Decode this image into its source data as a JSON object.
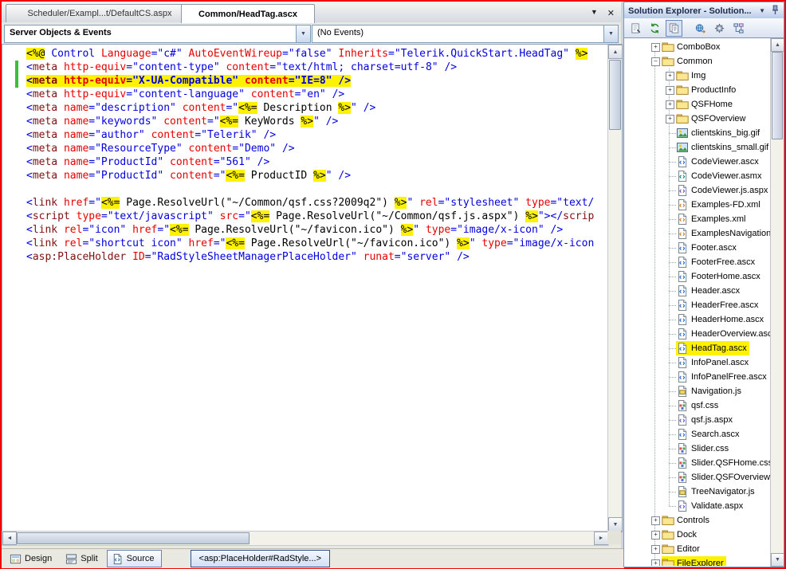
{
  "icons": {
    "tab_menu": "▼",
    "tab_close": "✕",
    "combo_arrow": "▼",
    "title_menu": "▼",
    "scroll_up": "▲",
    "scroll_down": "▼",
    "scroll_left": "◄",
    "scroll_right": "►"
  },
  "editor": {
    "tabs": [
      {
        "label": "Scheduler/Exampl...t/DefaultCS.aspx"
      },
      {
        "label": "Common/HeadTag.ascx"
      }
    ],
    "object_dropdown": "Server Objects & Events",
    "events_dropdown": "(No Events)",
    "view_buttons": [
      {
        "label": "Design"
      },
      {
        "label": "Split"
      },
      {
        "label": "Source"
      }
    ],
    "breadcrumb_tab": "<asp:PlaceHolder#RadStyle...>"
  },
  "code": {
    "lines": [
      {
        "segs": [
          [
            "s",
            "<%@"
          ],
          [
            "x",
            " "
          ],
          [
            "k",
            "Control"
          ],
          [
            "x",
            " "
          ],
          [
            "a",
            "Language"
          ],
          [
            "v",
            "=\"c#\""
          ],
          [
            "x",
            " "
          ],
          [
            "a",
            "AutoEventWireup"
          ],
          [
            "v",
            "=\"false\""
          ],
          [
            "x",
            " "
          ],
          [
            "a",
            "Inherits"
          ],
          [
            "v",
            "=\"Telerik.QuickStart.HeadTag\""
          ],
          [
            "x",
            " "
          ],
          [
            "s",
            "%>"
          ]
        ]
      },
      {
        "bar": true,
        "segs": [
          [
            "d",
            "<"
          ],
          [
            "t",
            "meta"
          ],
          [
            "x",
            " "
          ],
          [
            "a",
            "http-equiv"
          ],
          [
            "v",
            "=\"content-type\""
          ],
          [
            "x",
            " "
          ],
          [
            "a",
            "content"
          ],
          [
            "v",
            "=\"text/html; charset=utf-8\""
          ],
          [
            "x",
            " "
          ],
          [
            "d",
            "/>"
          ]
        ]
      },
      {
        "bar": true,
        "hl": true,
        "segs": [
          [
            "d",
            "<"
          ],
          [
            "t",
            "meta"
          ],
          [
            "x",
            " "
          ],
          [
            "a",
            "http-equiv"
          ],
          [
            "v",
            "=\"X-UA-Compatible\""
          ],
          [
            "x",
            " "
          ],
          [
            "a",
            "content"
          ],
          [
            "v",
            "=\"IE=8\""
          ],
          [
            "x",
            " "
          ],
          [
            "d",
            "/>"
          ]
        ]
      },
      {
        "segs": [
          [
            "d",
            "<"
          ],
          [
            "t",
            "meta"
          ],
          [
            "x",
            " "
          ],
          [
            "a",
            "http-equiv"
          ],
          [
            "v",
            "=\"content-language\""
          ],
          [
            "x",
            " "
          ],
          [
            "a",
            "content"
          ],
          [
            "v",
            "=\"en\""
          ],
          [
            "x",
            " "
          ],
          [
            "d",
            "/>"
          ]
        ]
      },
      {
        "segs": [
          [
            "d",
            "<"
          ],
          [
            "t",
            "meta"
          ],
          [
            "x",
            " "
          ],
          [
            "a",
            "name"
          ],
          [
            "v",
            "=\"description\""
          ],
          [
            "x",
            " "
          ],
          [
            "a",
            "content"
          ],
          [
            "v",
            "=\""
          ],
          [
            "s",
            "<%="
          ],
          [
            "x",
            " Description "
          ],
          [
            "s",
            "%>"
          ],
          [
            "v",
            "\""
          ],
          [
            "x",
            " "
          ],
          [
            "d",
            "/>"
          ]
        ]
      },
      {
        "segs": [
          [
            "d",
            "<"
          ],
          [
            "t",
            "meta"
          ],
          [
            "x",
            " "
          ],
          [
            "a",
            "name"
          ],
          [
            "v",
            "=\"keywords\""
          ],
          [
            "x",
            " "
          ],
          [
            "a",
            "content"
          ],
          [
            "v",
            "=\""
          ],
          [
            "s",
            "<%="
          ],
          [
            "x",
            " KeyWords "
          ],
          [
            "s",
            "%>"
          ],
          [
            "v",
            "\""
          ],
          [
            "x",
            " "
          ],
          [
            "d",
            "/>"
          ]
        ]
      },
      {
        "segs": [
          [
            "d",
            "<"
          ],
          [
            "t",
            "meta"
          ],
          [
            "x",
            " "
          ],
          [
            "a",
            "name"
          ],
          [
            "v",
            "=\"author\""
          ],
          [
            "x",
            " "
          ],
          [
            "a",
            "content"
          ],
          [
            "v",
            "=\"Telerik\""
          ],
          [
            "x",
            " "
          ],
          [
            "d",
            "/>"
          ]
        ]
      },
      {
        "segs": [
          [
            "d",
            "<"
          ],
          [
            "t",
            "meta"
          ],
          [
            "x",
            " "
          ],
          [
            "a",
            "name"
          ],
          [
            "v",
            "=\"ResourceType\""
          ],
          [
            "x",
            " "
          ],
          [
            "a",
            "content"
          ],
          [
            "v",
            "=\"Demo\""
          ],
          [
            "x",
            " "
          ],
          [
            "d",
            "/>"
          ]
        ]
      },
      {
        "segs": [
          [
            "d",
            "<"
          ],
          [
            "t",
            "meta"
          ],
          [
            "x",
            " "
          ],
          [
            "a",
            "name"
          ],
          [
            "v",
            "=\"ProductId\""
          ],
          [
            "x",
            " "
          ],
          [
            "a",
            "content"
          ],
          [
            "v",
            "=\"561\""
          ],
          [
            "x",
            " "
          ],
          [
            "d",
            "/>"
          ]
        ]
      },
      {
        "segs": [
          [
            "d",
            "<"
          ],
          [
            "t",
            "meta"
          ],
          [
            "x",
            " "
          ],
          [
            "a",
            "name"
          ],
          [
            "v",
            "=\"ProductId\""
          ],
          [
            "x",
            " "
          ],
          [
            "a",
            "content"
          ],
          [
            "v",
            "=\""
          ],
          [
            "s",
            "<%="
          ],
          [
            "x",
            " ProductID "
          ],
          [
            "s",
            "%>"
          ],
          [
            "v",
            "\""
          ],
          [
            "x",
            " "
          ],
          [
            "d",
            "/>"
          ]
        ]
      },
      {
        "segs": []
      },
      {
        "segs": [
          [
            "d",
            "<"
          ],
          [
            "t",
            "link"
          ],
          [
            "x",
            " "
          ],
          [
            "a",
            "href"
          ],
          [
            "v",
            "=\""
          ],
          [
            "s",
            "<%="
          ],
          [
            "x",
            " Page.ResolveUrl(\"~/Common/qsf.css?2009q2\") "
          ],
          [
            "s",
            "%>"
          ],
          [
            "v",
            "\""
          ],
          [
            "x",
            " "
          ],
          [
            "a",
            "rel"
          ],
          [
            "v",
            "=\"stylesheet\""
          ],
          [
            "x",
            " "
          ],
          [
            "a",
            "type"
          ],
          [
            "v",
            "=\"text/"
          ]
        ]
      },
      {
        "segs": [
          [
            "d",
            "<"
          ],
          [
            "t",
            "script"
          ],
          [
            "x",
            " "
          ],
          [
            "a",
            "type"
          ],
          [
            "v",
            "=\"text/javascript\""
          ],
          [
            "x",
            " "
          ],
          [
            "a",
            "src"
          ],
          [
            "v",
            "=\""
          ],
          [
            "s",
            "<%="
          ],
          [
            "x",
            " Page.ResolveUrl(\"~/Common/qsf.js.aspx\") "
          ],
          [
            "s",
            "%>"
          ],
          [
            "v",
            "\""
          ],
          [
            "d",
            "></"
          ],
          [
            "t",
            "scrip"
          ]
        ]
      },
      {
        "segs": [
          [
            "d",
            "<"
          ],
          [
            "t",
            "link"
          ],
          [
            "x",
            " "
          ],
          [
            "a",
            "rel"
          ],
          [
            "v",
            "=\"icon\""
          ],
          [
            "x",
            " "
          ],
          [
            "a",
            "href"
          ],
          [
            "v",
            "=\""
          ],
          [
            "s",
            "<%="
          ],
          [
            "x",
            " Page.ResolveUrl(\"~/favicon.ico\") "
          ],
          [
            "s",
            "%>"
          ],
          [
            "v",
            "\""
          ],
          [
            "x",
            " "
          ],
          [
            "a",
            "type"
          ],
          [
            "v",
            "=\"image/x-icon\""
          ],
          [
            "x",
            " "
          ],
          [
            "d",
            "/>"
          ]
        ]
      },
      {
        "segs": [
          [
            "d",
            "<"
          ],
          [
            "t",
            "link"
          ],
          [
            "x",
            " "
          ],
          [
            "a",
            "rel"
          ],
          [
            "v",
            "=\"shortcut icon\""
          ],
          [
            "x",
            " "
          ],
          [
            "a",
            "href"
          ],
          [
            "v",
            "=\""
          ],
          [
            "s",
            "<%="
          ],
          [
            "x",
            " Page.ResolveUrl(\"~/favicon.ico\") "
          ],
          [
            "s",
            "%>"
          ],
          [
            "v",
            "\""
          ],
          [
            "x",
            " "
          ],
          [
            "a",
            "type"
          ],
          [
            "v",
            "=\"image/x-icon"
          ]
        ]
      },
      {
        "segs": [
          [
            "d",
            "<"
          ],
          [
            "t",
            "asp:PlaceHolder"
          ],
          [
            "x",
            " "
          ],
          [
            "a",
            "ID"
          ],
          [
            "v",
            "=\"RadStyleSheetManagerPlaceHolder\""
          ],
          [
            "x",
            " "
          ],
          [
            "a",
            "runat"
          ],
          [
            "v",
            "=\"server\""
          ],
          [
            "x",
            " "
          ],
          [
            "d",
            "/>"
          ]
        ]
      }
    ]
  },
  "solution_explorer": {
    "title": "Solution Explorer - Solution...",
    "tree": [
      {
        "label": "ComboBox",
        "icon": "folder",
        "level": 1,
        "exp": "+"
      },
      {
        "label": "Common",
        "icon": "folder",
        "level": 1,
        "exp": "-"
      },
      {
        "label": "Img",
        "icon": "folder",
        "level": 2,
        "exp": "+"
      },
      {
        "label": "ProductInfo",
        "icon": "folder",
        "level": 2,
        "exp": "+"
      },
      {
        "label": "QSFHome",
        "icon": "folder",
        "level": 2,
        "exp": "+"
      },
      {
        "label": "QSFOverview",
        "icon": "folder",
        "level": 2,
        "exp": "+"
      },
      {
        "label": "clientskins_big.gif",
        "icon": "image",
        "level": 2
      },
      {
        "label": "clientskins_small.gif",
        "icon": "image",
        "level": 2
      },
      {
        "label": "CodeViewer.ascx",
        "icon": "ascx",
        "level": 2
      },
      {
        "label": "CodeViewer.asmx",
        "icon": "asmx",
        "level": 2
      },
      {
        "label": "CodeViewer.js.aspx",
        "icon": "aspx",
        "level": 2
      },
      {
        "label": "Examples-FD.xml",
        "icon": "xml",
        "level": 2
      },
      {
        "label": "Examples.xml",
        "icon": "xml",
        "level": 2
      },
      {
        "label": "ExamplesNavigation",
        "icon": "xml",
        "level": 2
      },
      {
        "label": "Footer.ascx",
        "icon": "ascx",
        "level": 2
      },
      {
        "label": "FooterFree.ascx",
        "icon": "ascx",
        "level": 2
      },
      {
        "label": "FooterHome.ascx",
        "icon": "ascx",
        "level": 2
      },
      {
        "label": "Header.ascx",
        "icon": "ascx",
        "level": 2
      },
      {
        "label": "HeaderFree.ascx",
        "icon": "ascx",
        "level": 2
      },
      {
        "label": "HeaderHome.ascx",
        "icon": "ascx",
        "level": 2
      },
      {
        "label": "HeaderOverview.asc",
        "icon": "ascx",
        "level": 2
      },
      {
        "label": "HeadTag.ascx",
        "icon": "ascx",
        "level": 2,
        "highlight": true
      },
      {
        "label": "InfoPanel.ascx",
        "icon": "ascx",
        "level": 2
      },
      {
        "label": "InfoPanelFree.ascx",
        "icon": "ascx",
        "level": 2
      },
      {
        "label": "Navigation.js",
        "icon": "js",
        "level": 2
      },
      {
        "label": "qsf.css",
        "icon": "css",
        "level": 2
      },
      {
        "label": "qsf.js.aspx",
        "icon": "aspx",
        "level": 2
      },
      {
        "label": "Search.ascx",
        "icon": "ascx",
        "level": 2
      },
      {
        "label": "Slider.css",
        "icon": "css",
        "level": 2
      },
      {
        "label": "Slider.QSFHome.css",
        "icon": "css",
        "level": 2
      },
      {
        "label": "Slider.QSFOverview.",
        "icon": "css",
        "level": 2
      },
      {
        "label": "TreeNavigator.js",
        "icon": "js",
        "level": 2
      },
      {
        "label": "Validate.aspx",
        "icon": "aspx",
        "level": 2
      },
      {
        "label": "Controls",
        "icon": "folder",
        "level": 1,
        "exp": "+"
      },
      {
        "label": "Dock",
        "icon": "folder",
        "level": 1,
        "exp": "+"
      },
      {
        "label": "Editor",
        "icon": "folder",
        "level": 1,
        "exp": "+"
      },
      {
        "label": "FileExplorer",
        "icon": "folder",
        "level": 1,
        "exp": "+",
        "highlight": true,
        "partial": true
      }
    ]
  }
}
